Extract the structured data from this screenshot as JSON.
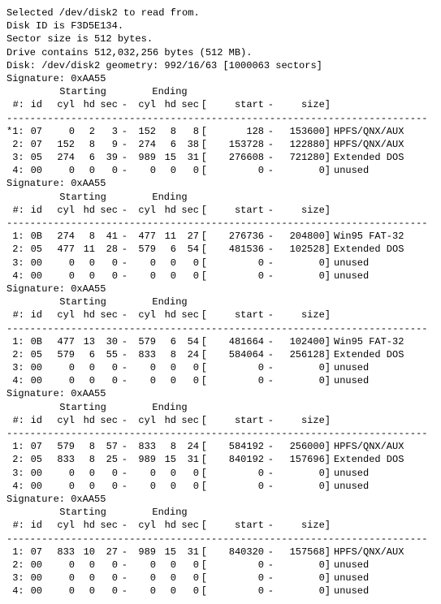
{
  "info": {
    "selected": "Selected /dev/disk2 to read from.",
    "diskid": "Disk ID is F3D5E134.",
    "sector": "Sector size is 512 bytes.",
    "drive": "Drive contains 512,032,256 bytes (512 MB)."
  },
  "disk_line": "Disk: /dev/disk2   geometry: 992/16/63 [1000063 sectors]",
  "sig_label": "Signature: 0xAA55",
  "header": {
    "starting": "Starting",
    "ending": "Ending",
    "h1": " #:",
    "h2": "id",
    "h3": "cyl",
    "h4": "hd",
    "h5": "sec",
    "h6": "cyl",
    "h7": "hd",
    "h8": "sec",
    "h9": "start",
    "h10": "size]"
  },
  "tables": [
    {
      "rows": [
        {
          "n": "*1:",
          "id": "07",
          "sc": "0",
          "sh": "2",
          "ss": "3",
          "ec": "152",
          "eh": "8",
          "es": "8",
          "start": "128",
          "size": "153600]",
          "desc": "HPFS/QNX/AUX"
        },
        {
          "n": " 2:",
          "id": "07",
          "sc": "152",
          "sh": "8",
          "ss": "9",
          "ec": "274",
          "eh": "6",
          "es": "38",
          "start": "153728",
          "size": "122880]",
          "desc": "HPFS/QNX/AUX"
        },
        {
          "n": " 3:",
          "id": "05",
          "sc": "274",
          "sh": "6",
          "ss": "39",
          "ec": "989",
          "eh": "15",
          "es": "31",
          "start": "276608",
          "size": "721280]",
          "desc": "Extended DOS"
        },
        {
          "n": " 4:",
          "id": "00",
          "sc": "0",
          "sh": "0",
          "ss": "0",
          "ec": "0",
          "eh": "0",
          "es": "0",
          "start": "0",
          "size": "0]",
          "desc": "unused"
        }
      ]
    },
    {
      "rows": [
        {
          "n": " 1:",
          "id": "0B",
          "sc": "274",
          "sh": "8",
          "ss": "41",
          "ec": "477",
          "eh": "11",
          "es": "27",
          "start": "276736",
          "size": "204800]",
          "desc": "Win95 FAT-32"
        },
        {
          "n": " 2:",
          "id": "05",
          "sc": "477",
          "sh": "11",
          "ss": "28",
          "ec": "579",
          "eh": "6",
          "es": "54",
          "start": "481536",
          "size": "102528]",
          "desc": "Extended DOS"
        },
        {
          "n": " 3:",
          "id": "00",
          "sc": "0",
          "sh": "0",
          "ss": "0",
          "ec": "0",
          "eh": "0",
          "es": "0",
          "start": "0",
          "size": "0]",
          "desc": "unused"
        },
        {
          "n": " 4:",
          "id": "00",
          "sc": "0",
          "sh": "0",
          "ss": "0",
          "ec": "0",
          "eh": "0",
          "es": "0",
          "start": "0",
          "size": "0]",
          "desc": "unused"
        }
      ]
    },
    {
      "rows": [
        {
          "n": " 1:",
          "id": "0B",
          "sc": "477",
          "sh": "13",
          "ss": "30",
          "ec": "579",
          "eh": "6",
          "es": "54",
          "start": "481664",
          "size": "102400]",
          "desc": "Win95 FAT-32"
        },
        {
          "n": " 2:",
          "id": "05",
          "sc": "579",
          "sh": "6",
          "ss": "55",
          "ec": "833",
          "eh": "8",
          "es": "24",
          "start": "584064",
          "size": "256128]",
          "desc": "Extended DOS"
        },
        {
          "n": " 3:",
          "id": "00",
          "sc": "0",
          "sh": "0",
          "ss": "0",
          "ec": "0",
          "eh": "0",
          "es": "0",
          "start": "0",
          "size": "0]",
          "desc": "unused"
        },
        {
          "n": " 4:",
          "id": "00",
          "sc": "0",
          "sh": "0",
          "ss": "0",
          "ec": "0",
          "eh": "0",
          "es": "0",
          "start": "0",
          "size": "0]",
          "desc": "unused"
        }
      ]
    },
    {
      "rows": [
        {
          "n": " 1:",
          "id": "07",
          "sc": "579",
          "sh": "8",
          "ss": "57",
          "ec": "833",
          "eh": "8",
          "es": "24",
          "start": "584192",
          "size": "256000]",
          "desc": "HPFS/QNX/AUX"
        },
        {
          "n": " 2:",
          "id": "05",
          "sc": "833",
          "sh": "8",
          "ss": "25",
          "ec": "989",
          "eh": "15",
          "es": "31",
          "start": "840192",
          "size": "157696]",
          "desc": "Extended DOS"
        },
        {
          "n": " 3:",
          "id": "00",
          "sc": "0",
          "sh": "0",
          "ss": "0",
          "ec": "0",
          "eh": "0",
          "es": "0",
          "start": "0",
          "size": "0]",
          "desc": "unused"
        },
        {
          "n": " 4:",
          "id": "00",
          "sc": "0",
          "sh": "0",
          "ss": "0",
          "ec": "0",
          "eh": "0",
          "es": "0",
          "start": "0",
          "size": "0]",
          "desc": "unused"
        }
      ]
    },
    {
      "rows": [
        {
          "n": " 1:",
          "id": "07",
          "sc": "833",
          "sh": "10",
          "ss": "27",
          "ec": "989",
          "eh": "15",
          "es": "31",
          "start": "840320",
          "size": "157568]",
          "desc": "HPFS/QNX/AUX"
        },
        {
          "n": " 2:",
          "id": "00",
          "sc": "0",
          "sh": "0",
          "ss": "0",
          "ec": "0",
          "eh": "0",
          "es": "0",
          "start": "0",
          "size": "0]",
          "desc": "unused"
        },
        {
          "n": " 3:",
          "id": "00",
          "sc": "0",
          "sh": "0",
          "ss": "0",
          "ec": "0",
          "eh": "0",
          "es": "0",
          "start": "0",
          "size": "0]",
          "desc": "unused"
        },
        {
          "n": " 4:",
          "id": "00",
          "sc": "0",
          "sh": "0",
          "ss": "0",
          "ec": "0",
          "eh": "0",
          "es": "0",
          "start": "0",
          "size": "0]",
          "desc": "unused"
        }
      ]
    }
  ]
}
